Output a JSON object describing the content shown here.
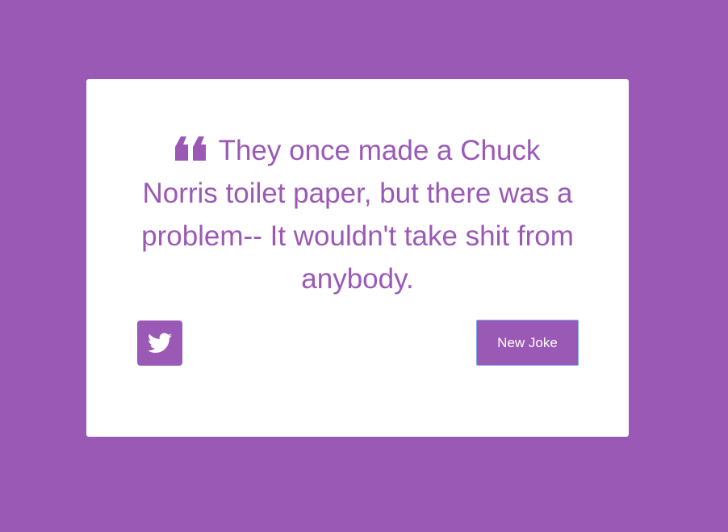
{
  "theme": {
    "background": "#9b59b6",
    "card": "#ffffff",
    "accent": "#9b59b6",
    "button_text": "#ffffff",
    "focus_border": "#7aa7ee"
  },
  "quote": {
    "icon": "quote-left-icon",
    "text": "They once made a Chuck Norris toilet paper, but there was a problem-- It wouldn't take shit from anybody."
  },
  "actions": {
    "tweet_icon": "twitter-icon",
    "new_joke_label": "New Joke"
  }
}
